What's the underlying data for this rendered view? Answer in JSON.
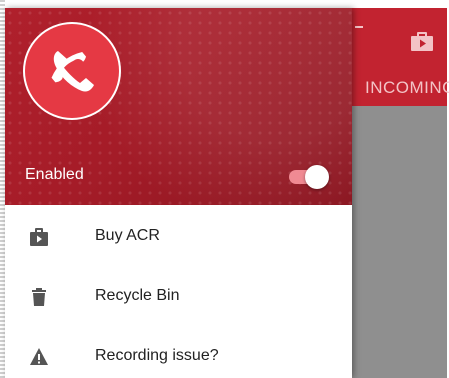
{
  "background_app": {
    "appbar_color": "#c22330",
    "tab_label": "INCOMING",
    "appbar_icon": "shop-icon"
  },
  "drawer": {
    "header": {
      "logo_icon": "phone-record-icon",
      "enabled_label": "Enabled",
      "enabled_toggle_on": true
    },
    "items": [
      {
        "label": "Buy ACR",
        "icon": "shop-icon"
      },
      {
        "label": "Recycle Bin",
        "icon": "trash-icon"
      },
      {
        "label": "Recording issue?",
        "icon": "warning-icon"
      }
    ]
  },
  "colors": {
    "accent": "#c22330",
    "logo_circle": "#e53944",
    "toggle_track": "#f08a93"
  }
}
